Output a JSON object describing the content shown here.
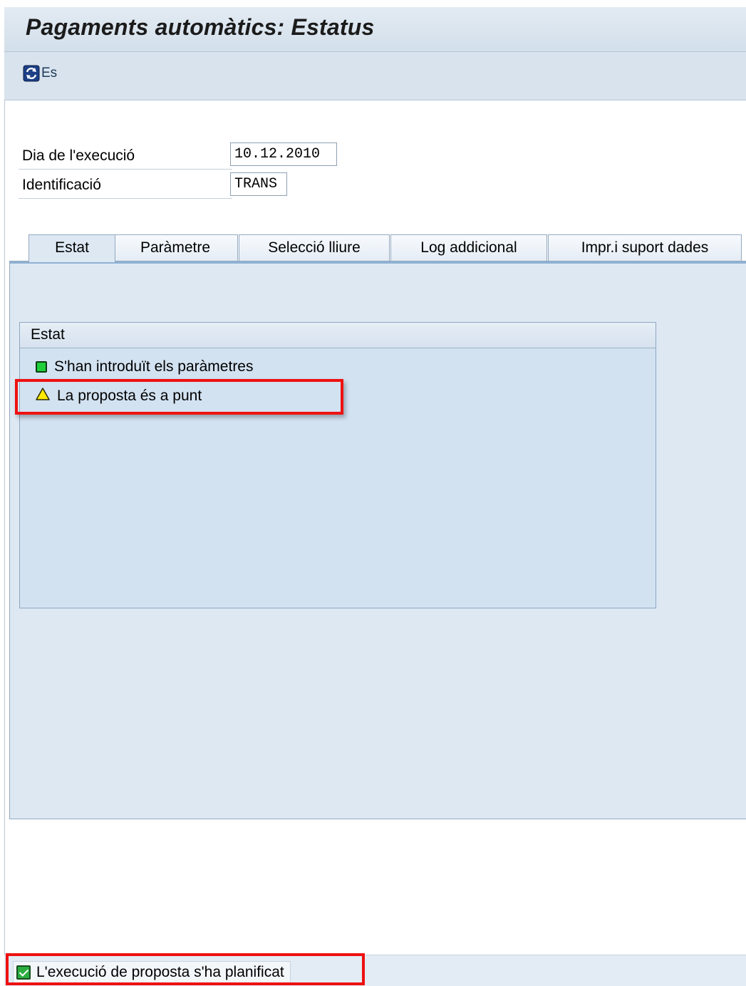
{
  "window": {
    "title": "Pagaments automàtics: Estatus"
  },
  "toolbar": {
    "refresh_label": "Es",
    "refresh_icon": "refresh-icon"
  },
  "fields": {
    "run_date": {
      "label": "Dia de l'execució",
      "value": "10.12.2010"
    },
    "identification": {
      "label": "Identificació",
      "value": "TRANS"
    }
  },
  "tabs": [
    {
      "label": "Estat",
      "active": true
    },
    {
      "label": "Paràmetre",
      "active": false
    },
    {
      "label": "Selecció lliure",
      "active": false
    },
    {
      "label": "Log addicional",
      "active": false
    },
    {
      "label": "Impr.i suport dades",
      "active": false
    }
  ],
  "status_group": {
    "title": "Estat",
    "items": [
      {
        "text": "S'han introduït els paràmetres",
        "icon": "green-square-icon"
      },
      {
        "text": "La proposta és a punt",
        "icon": "warning-triangle-icon"
      }
    ]
  },
  "status_bar": {
    "message": "L'execució de proposta s'ha planificat",
    "icon": "success-check-icon"
  },
  "colors": {
    "highlight": "#ee1111",
    "panel": "#dde8f3",
    "success": "#2bae3e",
    "warning": "#ffe900"
  }
}
